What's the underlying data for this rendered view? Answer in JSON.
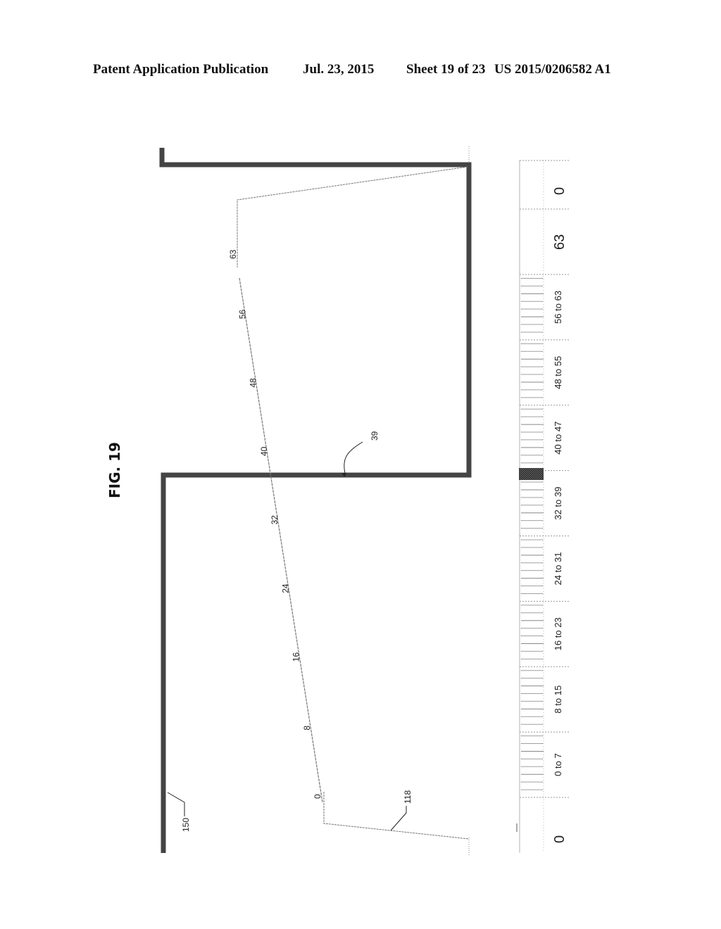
{
  "header": {
    "publication": "Patent Application Publication",
    "date": "Jul. 23, 2015",
    "sheet": "Sheet 19 of 23",
    "number": "US 2015/0206582 A1"
  },
  "figure": {
    "title": "FIG. 19",
    "refs": {
      "waveform": "150",
      "ramp": "118",
      "transition": "39"
    },
    "ramp_labels": [
      "0",
      "8",
      "16",
      "24",
      "32",
      "40",
      "48",
      "56",
      "63"
    ],
    "scale": {
      "end_left": "0",
      "end_right": "0",
      "peak": "63",
      "ranges": [
        "0 to 7",
        "8 to 15",
        "16 to 23",
        "24 to 31",
        "32 to 39",
        "40 to 47",
        "48 to 55",
        "56 to 63"
      ],
      "highlight_value": 39
    }
  }
}
